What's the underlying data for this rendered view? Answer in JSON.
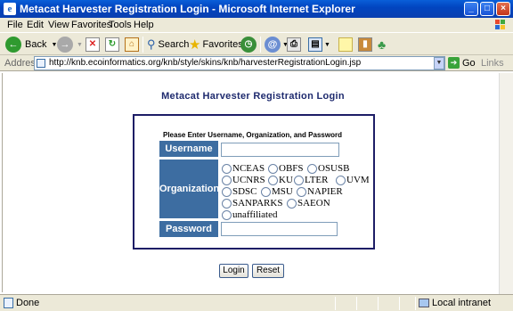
{
  "window": {
    "title": "Metacat Harvester Registration Login - Microsoft Internet Explorer",
    "icon": "ie-icon",
    "buttons": [
      "minimize",
      "maximize",
      "close"
    ]
  },
  "menu": {
    "items": [
      {
        "label": "File"
      },
      {
        "label": "Edit"
      },
      {
        "label": "View"
      },
      {
        "label": "Favorites"
      },
      {
        "label": "Tools"
      },
      {
        "label": "Help"
      }
    ]
  },
  "toolbar": {
    "back_label": "Back",
    "search_label": "Search",
    "favorites_label": "Favorites"
  },
  "address": {
    "label": "Address",
    "url": "http://knb.ecoinformatics.org/knb/style/skins/knb/harvesterRegistrationLogin.jsp",
    "go_label": "Go",
    "links_label": "Links"
  },
  "page": {
    "title": "Metacat Harvester Registration Login",
    "instructions": "Please Enter Username, Organization, and Password",
    "username_label": "Username",
    "username_value": "",
    "organization_label": "Organization",
    "organizations": [
      "NCEAS",
      "OBFS",
      "OSUSB",
      "UCNRS",
      "KU",
      "LTER",
      "UVM",
      "SDSC",
      "MSU",
      "NAPIER",
      "SANPARKS",
      "SAEON",
      "unaffiliated"
    ],
    "password_label": "Password",
    "password_value": "",
    "login_label": "Login",
    "reset_label": "Reset"
  },
  "status": {
    "text": "Done",
    "zone": "Local intranet"
  },
  "colors": {
    "label_bg": "#3d6da1",
    "title_text": "#1e2a6e",
    "box_border": "#1d1d66"
  }
}
